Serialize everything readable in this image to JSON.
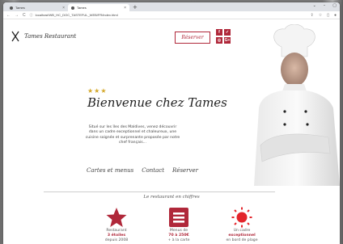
{
  "browser": {
    "tabs": [
      {
        "label": "Tames"
      },
      {
        "label": "Tames"
      }
    ],
    "new_tab": "+",
    "url": "localhost/WB_HC_DOC_TASTEFUL_WEB/FR/index.html"
  },
  "site": {
    "brand": "Tames Restaurant",
    "reserve_button": "Réserver",
    "social": [
      "f",
      "✓",
      "◎",
      "G+"
    ],
    "stars": "★★★",
    "welcome_title": "Bienvenue chez Tames",
    "intro": "Situé sur les îles des Maldives, venez découvrir dans un cadre exceptionnel et chaleureux, une cuisine soignée et surprenante proposée par notre chef français...",
    "links": [
      "Cartes et menus",
      "Contact",
      "Réserver"
    ],
    "section_title": "Le restaurant en chiffres",
    "stats": [
      {
        "line1": "Restaurant",
        "strong": "3 étoiles",
        "line2": "depuis 2008"
      },
      {
        "line1": "Menus de",
        "strong": "70 à 250€",
        "line2": "+ à la carte"
      },
      {
        "line1": "Un cadre",
        "strong": "exceptionnel",
        "line2": "en bord de plage"
      }
    ]
  },
  "colors": {
    "accent": "#b0283a",
    "star": "#d4a82a"
  }
}
